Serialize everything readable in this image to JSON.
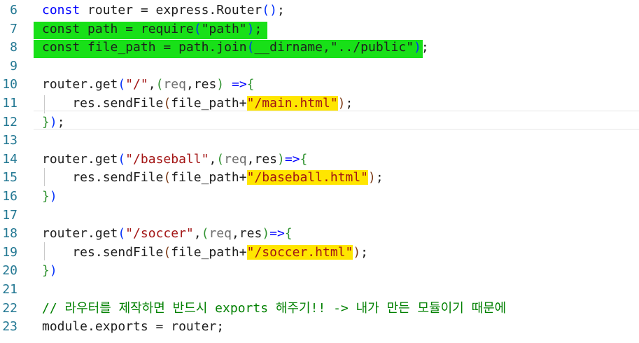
{
  "editor": {
    "lines": [
      {
        "num": "6",
        "segments": [
          {
            "t": "const",
            "c": "kw"
          },
          {
            "t": " router = express.Router",
            "c": "fn"
          },
          {
            "t": "(",
            "c": "p1"
          },
          {
            "t": ")",
            "c": "p1"
          },
          {
            "t": ";",
            "c": "fn"
          }
        ]
      },
      {
        "num": "7",
        "segments": [
          {
            "t": "const path = require",
            "c": "fn"
          },
          {
            "t": "(",
            "c": "p1"
          },
          {
            "t": "\"path\"",
            "c": "fn"
          },
          {
            "t": ")",
            "c": "p1"
          },
          {
            "t": ";",
            "c": "fn"
          }
        ]
      },
      {
        "num": "8",
        "segments": [
          {
            "t": "const file_path = path.join",
            "c": "fn"
          },
          {
            "t": "(",
            "c": "p1"
          },
          {
            "t": "__dirname,\"../public\"",
            "c": "fn"
          },
          {
            "t": ")",
            "c": "p1"
          },
          {
            "t": ";",
            "c": "fn"
          }
        ]
      },
      {
        "num": "9",
        "segments": []
      },
      {
        "num": "10",
        "segments": [
          {
            "t": "router.get",
            "c": "fn"
          },
          {
            "t": "(",
            "c": "p1"
          },
          {
            "t": "\"/\"",
            "c": "str"
          },
          {
            "t": ",",
            "c": "fn"
          },
          {
            "t": "(",
            "c": "p2"
          },
          {
            "t": "req",
            "c": "dim"
          },
          {
            "t": ",res",
            "c": "fn"
          },
          {
            "t": ")",
            "c": "p2"
          },
          {
            "t": " =>",
            "c": "kw"
          },
          {
            "t": "{",
            "c": "p2"
          }
        ]
      },
      {
        "num": "11",
        "segments": [
          {
            "t": "    res.sendFile",
            "c": "fn"
          },
          {
            "t": "(",
            "c": "p3"
          },
          {
            "t": "file_path+",
            "c": "fn"
          },
          {
            "t": "\"/main.html\"",
            "c": "str",
            "hl": true
          },
          {
            "t": ")",
            "c": "p3"
          },
          {
            "t": ";",
            "c": "fn"
          }
        ]
      },
      {
        "num": "12",
        "segments": [
          {
            "t": "}",
            "c": "p2"
          },
          {
            "t": ")",
            "c": "p1"
          },
          {
            "t": ";",
            "c": "fn"
          }
        ]
      },
      {
        "num": "13",
        "segments": []
      },
      {
        "num": "14",
        "segments": [
          {
            "t": "router.get",
            "c": "fn"
          },
          {
            "t": "(",
            "c": "p1"
          },
          {
            "t": "\"/baseball\"",
            "c": "str"
          },
          {
            "t": ",",
            "c": "fn"
          },
          {
            "t": "(",
            "c": "p2"
          },
          {
            "t": "req",
            "c": "dim"
          },
          {
            "t": ",res",
            "c": "fn"
          },
          {
            "t": ")",
            "c": "p2"
          },
          {
            "t": "=>",
            "c": "kw"
          },
          {
            "t": "{",
            "c": "p2"
          }
        ]
      },
      {
        "num": "15",
        "segments": [
          {
            "t": "    res.sendFile",
            "c": "fn"
          },
          {
            "t": "(",
            "c": "p3"
          },
          {
            "t": "file_path+",
            "c": "fn"
          },
          {
            "t": "\"/baseball.html\"",
            "c": "str",
            "hl": true
          },
          {
            "t": ")",
            "c": "p3"
          },
          {
            "t": ";",
            "c": "fn"
          }
        ]
      },
      {
        "num": "16",
        "segments": [
          {
            "t": "}",
            "c": "p2"
          },
          {
            "t": ")",
            "c": "p1"
          }
        ]
      },
      {
        "num": "17",
        "segments": []
      },
      {
        "num": "18",
        "segments": [
          {
            "t": "router.get",
            "c": "fn"
          },
          {
            "t": "(",
            "c": "p1"
          },
          {
            "t": "\"/soccer\"",
            "c": "str"
          },
          {
            "t": ",",
            "c": "fn"
          },
          {
            "t": "(",
            "c": "p2"
          },
          {
            "t": "req",
            "c": "dim"
          },
          {
            "t": ",res",
            "c": "fn"
          },
          {
            "t": ")",
            "c": "p2"
          },
          {
            "t": "=>",
            "c": "kw"
          },
          {
            "t": "{",
            "c": "p2"
          }
        ]
      },
      {
        "num": "19",
        "segments": [
          {
            "t": "    res.sendFile",
            "c": "fn"
          },
          {
            "t": "(",
            "c": "p3"
          },
          {
            "t": "file_path+",
            "c": "fn"
          },
          {
            "t": "\"/soccer.html\"",
            "c": "str",
            "hl": true
          },
          {
            "t": ")",
            "c": "p3"
          },
          {
            "t": ";",
            "c": "fn"
          }
        ]
      },
      {
        "num": "20",
        "segments": [
          {
            "t": "}",
            "c": "p2"
          },
          {
            "t": ")",
            "c": "p1"
          }
        ]
      },
      {
        "num": "21",
        "segments": []
      },
      {
        "num": "22",
        "segments": [
          {
            "t": "// 라우터를 제작하면 반드시 exports 해주기!! -> 내가 만든 모듈이기 때문에",
            "c": "cm"
          }
        ]
      },
      {
        "num": "23",
        "segments": [
          {
            "t": "module.exports = router;",
            "c": "fn"
          }
        ]
      }
    ]
  },
  "colors": {
    "green_highlight": "#18e018",
    "yellow_highlight": "#ffe600",
    "line_number": "#237893",
    "keyword": "#0000ff",
    "string": "#a31515",
    "comment": "#008000"
  }
}
